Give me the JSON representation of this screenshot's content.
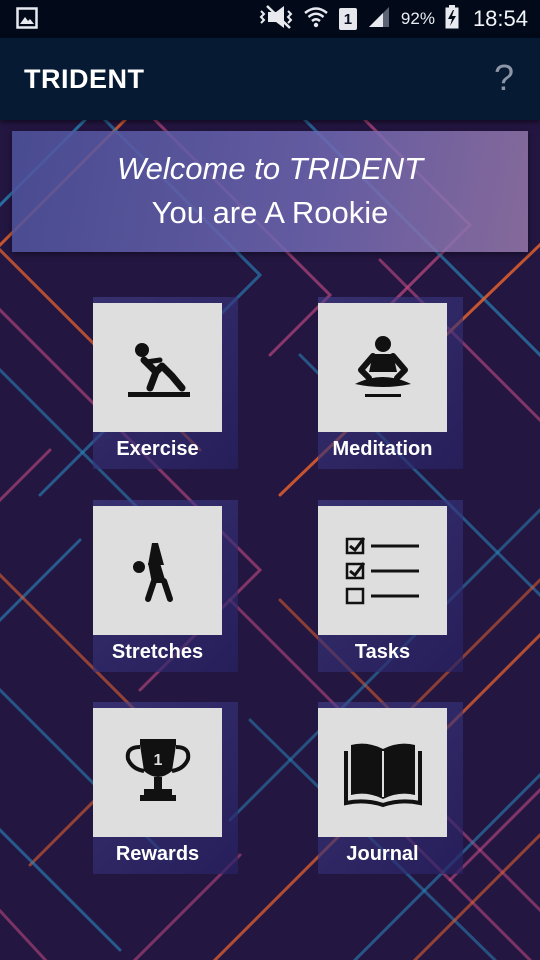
{
  "status_bar": {
    "battery_percent": "92%",
    "time": "18:54",
    "sim_slot": "1",
    "icons": [
      "gallery-icon",
      "mute-icon",
      "wifi-icon",
      "sim-icon",
      "signal-icon",
      "battery-charging-icon"
    ]
  },
  "app_bar": {
    "title": "TRIDENT",
    "help_label": "?"
  },
  "welcome": {
    "line1": "Welcome to TRIDENT",
    "line2": "You are A Rookie"
  },
  "menu": {
    "exercise": {
      "label": "Exercise",
      "icon": "situp-icon"
    },
    "meditation": {
      "label": "Meditation",
      "icon": "meditation-icon"
    },
    "stretches": {
      "label": "Stretches",
      "icon": "stretch-icon"
    },
    "tasks": {
      "label": "Tasks",
      "icon": "checklist-icon"
    },
    "rewards": {
      "label": "Rewards",
      "icon": "trophy-icon"
    },
    "journal": {
      "label": "Journal",
      "icon": "open-book-icon"
    }
  },
  "colors": {
    "app_bar": "#071a33",
    "status_bar": "#020a1a",
    "background": "#231641",
    "tile": "#dedede",
    "line_orange": "#e0602e",
    "line_blue": "#2a8bbf",
    "line_pink": "#c24c82"
  }
}
